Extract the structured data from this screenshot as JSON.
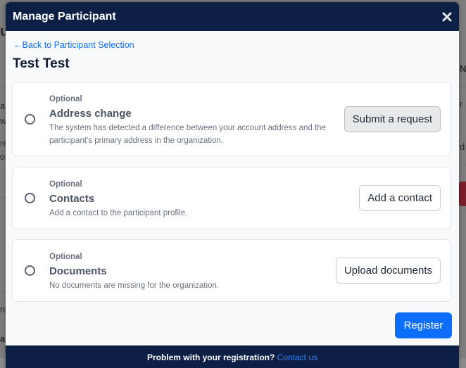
{
  "modal": {
    "title": "Manage Participant",
    "close_icon": "close-icon",
    "back_link": "←Back to Participant Selection",
    "participant_name": "Test Test"
  },
  "tasks": [
    {
      "tag": "Optional",
      "title": "Address change",
      "description": "The system has detected a difference between your account address and the participant's primary address in the organization.",
      "action_label": "Submit a request"
    },
    {
      "tag": "Optional",
      "title": "Contacts",
      "description": "Add a contact to the participant profile.",
      "action_label": "Add a contact"
    },
    {
      "tag": "Optional",
      "title": "Documents",
      "description": "No documents are missing for the organization.",
      "action_label": "Upload documents"
    }
  ],
  "register_label": "Register",
  "footer": {
    "text": "Problem with your registration?",
    "link": "Contact us"
  },
  "colors": {
    "header_bg": "#0d1f44",
    "accent": "#0d6efd",
    "backdrop": "#7d7d7d"
  }
}
